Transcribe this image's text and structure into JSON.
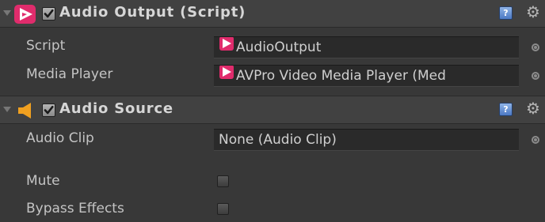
{
  "components": [
    {
      "title": "Audio Output (Script)",
      "enabled": true,
      "icon": "avpro-icon",
      "fields": [
        {
          "label": "Script",
          "value": "AudioOutput"
        },
        {
          "label": "Media Player",
          "value": "AVPro Video Media Player (Med"
        }
      ]
    },
    {
      "title": "Audio Source",
      "enabled": true,
      "icon": "audio-speaker-icon",
      "fields": [
        {
          "label": "Audio Clip",
          "value": "None (Audio Clip)"
        },
        {
          "label": "Mute",
          "checked": false
        },
        {
          "label": "Bypass Effects",
          "checked": false
        }
      ]
    }
  ],
  "icons": {
    "help": "help-icon",
    "settings": "gear-icon",
    "help_glyph": "?",
    "gear_glyph": "⚙"
  },
  "colors": {
    "background": "#383838",
    "header": "#414141",
    "field": "#2a2a2a",
    "avpro_pink": "#e02c6c",
    "speaker_orange": "#f0a020",
    "help_blue": "#4c79c4"
  }
}
